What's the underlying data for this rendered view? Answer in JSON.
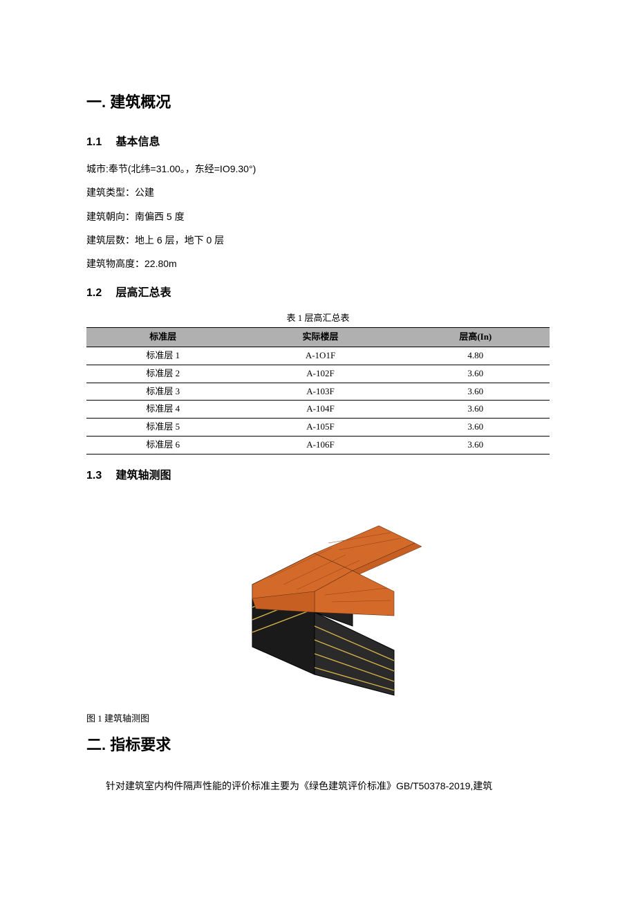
{
  "section1": {
    "heading": "一. 建筑概况",
    "sub1": {
      "num": "1.1",
      "title": "基本信息"
    },
    "info": {
      "city": "城市:奉节(北纬=31.00。，东经=IO9.30°)",
      "type": "建筑类型：公建",
      "orientation": "建筑朝向：南偏西 5 度",
      "floors": "建筑层数：地上 6 层，地下 0 层",
      "height": "建筑物高度：22.80m"
    },
    "sub2": {
      "num": "1.2",
      "title": "层高汇总表"
    },
    "table": {
      "caption": "表 1 层高汇总表",
      "headers": [
        "标准层",
        "实际楼层",
        "层高(In)"
      ],
      "rows": [
        [
          "标准层 1",
          "A-1O1F",
          "4.80"
        ],
        [
          "标准层 2",
          "A-102F",
          "3.60"
        ],
        [
          "标准层 3",
          "A-103F",
          "3.60"
        ],
        [
          "标准层 4",
          "A-104F",
          "3.60"
        ],
        [
          "标准层 5",
          "A-105F",
          "3.60"
        ],
        [
          "标准层 6",
          "A-106F",
          "3.60"
        ]
      ]
    },
    "sub3": {
      "num": "1.3",
      "title": "建筑轴测图"
    },
    "figcaption": "图 1 建筑轴测图"
  },
  "section2": {
    "heading": "二. 指标要求",
    "paragraph": "针对建筑室内构件隔声性能的评价标准主要为《绿色建筑评价标准》GB/T50378-2019,建筑"
  }
}
